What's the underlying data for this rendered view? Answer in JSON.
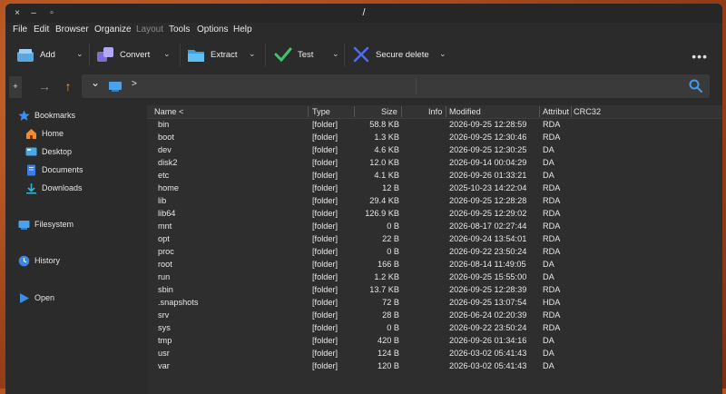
{
  "window": {
    "title": "/",
    "controls": {
      "close": "×",
      "minimize": "–",
      "maximize": "▫"
    }
  },
  "menu": [
    "File",
    "Edit",
    "Browser",
    "Organize",
    "Layout",
    "Tools",
    "Options",
    "Help"
  ],
  "toolbar": {
    "add": "Add",
    "convert": "Convert",
    "extract": "Extract",
    "test": "Test",
    "secure_delete": "Secure delete",
    "more": "•••"
  },
  "nav": {
    "new_tab": "+",
    "forward": "→",
    "up": "↑",
    "dropdown": "⌄",
    "breadcrumb_sep": ">"
  },
  "sidebar": {
    "bookmarks": "Bookmarks",
    "home": "Home",
    "desktop": "Desktop",
    "documents": "Documents",
    "downloads": "Downloads",
    "filesystem": "Filesystem",
    "history": "History",
    "open": "Open"
  },
  "columns": {
    "name": "Name <",
    "type": "Type",
    "size": "Size",
    "info": "Info",
    "modified": "Modified",
    "attributes": "Attribut",
    "crc32": "CRC32"
  },
  "files": [
    {
      "name": "bin",
      "type": "[folder]",
      "size": "58.8 KB",
      "modified": "2026-09-25 12:28:59",
      "attr": "RDA"
    },
    {
      "name": "boot",
      "type": "[folder]",
      "size": "1.3 KB",
      "modified": "2026-09-25 12:30:46",
      "attr": "RDA"
    },
    {
      "name": "dev",
      "type": "[folder]",
      "size": "4.6 KB",
      "modified": "2026-09-25 12:30:25",
      "attr": "DA"
    },
    {
      "name": "disk2",
      "type": "[folder]",
      "size": "12.0 KB",
      "modified": "2026-09-14 00:04:29",
      "attr": "DA"
    },
    {
      "name": "etc",
      "type": "[folder]",
      "size": "4.1 KB",
      "modified": "2026-09-26 01:33:21",
      "attr": "DA"
    },
    {
      "name": "home",
      "type": "[folder]",
      "size": "12 B",
      "modified": "2025-10-23 14:22:04",
      "attr": "RDA"
    },
    {
      "name": "lib",
      "type": "[folder]",
      "size": "29.4 KB",
      "modified": "2026-09-25 12:28:28",
      "attr": "RDA"
    },
    {
      "name": "lib64",
      "type": "[folder]",
      "size": "126.9 KB",
      "modified": "2026-09-25 12:29:02",
      "attr": "RDA"
    },
    {
      "name": "mnt",
      "type": "[folder]",
      "size": "0 B",
      "modified": "2026-08-17 02:27:44",
      "attr": "RDA"
    },
    {
      "name": "opt",
      "type": "[folder]",
      "size": "22 B",
      "modified": "2026-09-24 13:54:01",
      "attr": "RDA"
    },
    {
      "name": "proc",
      "type": "[folder]",
      "size": "0 B",
      "modified": "2026-09-22 23:50:24",
      "attr": "RDA"
    },
    {
      "name": "root",
      "type": "[folder]",
      "size": "166 B",
      "modified": "2026-08-14 11:49:05",
      "attr": "DA"
    },
    {
      "name": "run",
      "type": "[folder]",
      "size": "1.2 KB",
      "modified": "2026-09-25 15:55:00",
      "attr": "DA"
    },
    {
      "name": "sbin",
      "type": "[folder]",
      "size": "13.7 KB",
      "modified": "2026-09-25 12:28:39",
      "attr": "RDA"
    },
    {
      "name": ".snapshots",
      "type": "[folder]",
      "size": "72 B",
      "modified": "2026-09-25 13:07:54",
      "attr": "HDA"
    },
    {
      "name": "srv",
      "type": "[folder]",
      "size": "28 B",
      "modified": "2026-06-24 02:20:39",
      "attr": "RDA"
    },
    {
      "name": "sys",
      "type": "[folder]",
      "size": "0 B",
      "modified": "2026-09-22 23:50:24",
      "attr": "RDA"
    },
    {
      "name": "tmp",
      "type": "[folder]",
      "size": "420 B",
      "modified": "2026-09-26 01:34:16",
      "attr": "DA"
    },
    {
      "name": "usr",
      "type": "[folder]",
      "size": "124 B",
      "modified": "2026-03-02 05:41:43",
      "attr": "DA"
    },
    {
      "name": "var",
      "type": "[folder]",
      "size": "120 B",
      "modified": "2026-03-02 05:41:43",
      "attr": "DA"
    }
  ]
}
